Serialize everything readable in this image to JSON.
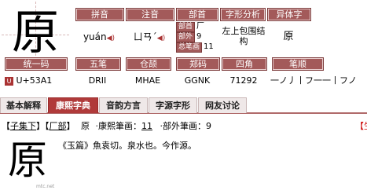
{
  "character": "原",
  "header_labels": [
    "拼音",
    "注音",
    "部首",
    "字形分析",
    "异体字"
  ],
  "pinyin": "yuán",
  "zhuyin": "ㄩㄢˊ",
  "bushou": {
    "bu_label": "部首",
    "bu_value": "厂",
    "wai_label": "部外",
    "wai_value": "9",
    "zong_label": "总笔画",
    "zong_value": "11"
  },
  "zixing": "左上包围结构",
  "yiti": "原",
  "header_labels2": [
    "统一码",
    "五笔",
    "仓颉",
    "郑码",
    "四角",
    "笔顺"
  ],
  "unicode": "U+53A1",
  "wubi": "DRII",
  "cangjie": "MHAE",
  "zhengma": "GGNK",
  "sijiao": "71292",
  "bishun": "一ノ丿丨フ一一丨フノ",
  "tabs": [
    "基本解释",
    "康熙字典",
    "音韵方言",
    "字源字形",
    "网友讨论"
  ],
  "kangxi": {
    "ji": "子集下",
    "bu": "厂部",
    "char": "原",
    "bihua_label": "康熙筆画：",
    "bihua": "11",
    "buwai_label": "部外筆画：",
    "buwai": "9",
    "right_fragment": "【生",
    "quote": "《玉篇》魚袁切。泉水也。今作源。",
    "watermark": "mtc.net"
  }
}
